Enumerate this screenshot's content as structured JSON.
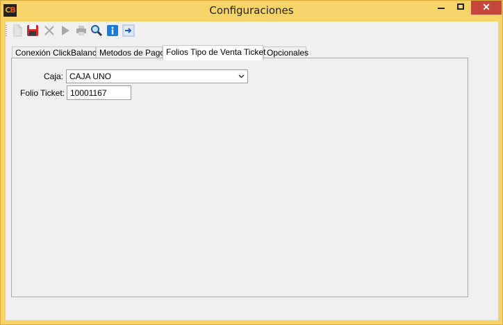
{
  "window": {
    "app_icon_left": "C",
    "app_icon_right": "B",
    "title": "Configuraciones",
    "close_label": "✕"
  },
  "toolbar": {
    "buttons": [
      {
        "icon": "new-document-icon"
      },
      {
        "icon": "save-icon"
      },
      {
        "icon": "delete-icon"
      },
      {
        "icon": "run-icon"
      },
      {
        "icon": "print-icon"
      },
      {
        "icon": "search-icon"
      },
      {
        "icon": "info-icon"
      },
      {
        "icon": "exit-icon"
      }
    ]
  },
  "tabs": [
    {
      "label": "Conexión ClickBalance"
    },
    {
      "label": "Metodos de Pago"
    },
    {
      "label": "Folios Tipo de Venta Ticket"
    },
    {
      "label": "Opcionales"
    }
  ],
  "active_tab": "Folios Tipo de Venta Ticket",
  "form": {
    "caja_label": "Caja:",
    "caja_value": "CAJA UNO",
    "folio_label": "Folio Ticket:",
    "folio_value": "10001167"
  },
  "colors": {
    "title_bar": "#f7d469",
    "close_button": "#c7463c",
    "save_icon": "#cc2b2b",
    "info_icon": "#1b7ad6"
  }
}
